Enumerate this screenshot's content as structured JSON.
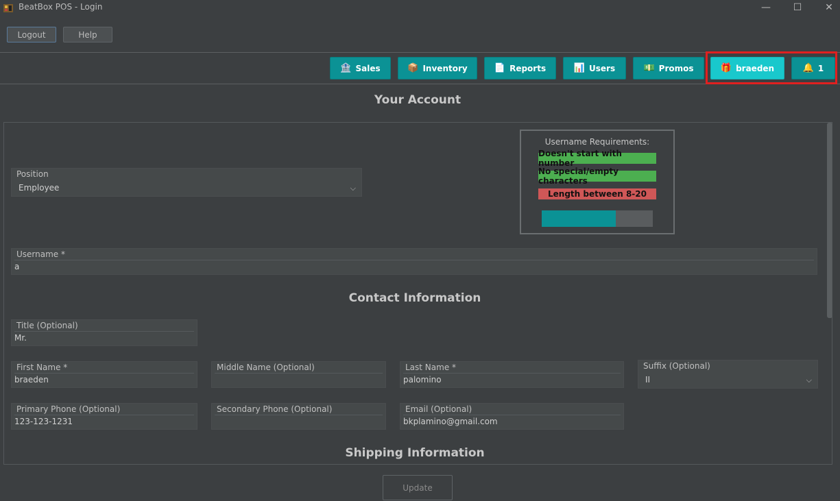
{
  "window": {
    "title": "BeatBox POS - Login",
    "minimize": "—",
    "maximize": "☐",
    "close": "✕"
  },
  "toolbar": {
    "logout_label": "Logout",
    "help_label": "Help"
  },
  "nav": {
    "sales": {
      "label": "Sales",
      "icon": "🏦"
    },
    "inventory": {
      "label": "Inventory",
      "icon": "📦"
    },
    "reports": {
      "label": "Reports",
      "icon": "📄"
    },
    "users": {
      "label": "Users",
      "icon": "📊"
    },
    "promos": {
      "label": "Promos",
      "icon": "💵"
    },
    "user": {
      "label": "braeden",
      "icon": "🎁"
    },
    "notifications": {
      "label": "1",
      "icon": "🔔"
    }
  },
  "colors": {
    "accent": "#0b9295",
    "active_user": "#19c8cc",
    "highlight": "#e02020",
    "req_ok": "#4caf50",
    "req_bad": "#cf5757"
  },
  "page_title": "Your Account",
  "form": {
    "position": {
      "label": "Position",
      "value": "Employee"
    },
    "username": {
      "label": "Username *",
      "value": "a"
    },
    "contact_heading": "Contact Information",
    "title_field": {
      "label": "Title (Optional)",
      "value": "Mr."
    },
    "first_name": {
      "label": "First Name *",
      "value": "braeden"
    },
    "middle_name": {
      "label": "Middle Name (Optional)",
      "value": ""
    },
    "last_name": {
      "label": "Last Name *",
      "value": "palomino"
    },
    "suffix": {
      "label": "Suffix (Optional)",
      "value": "II"
    },
    "primary_phone": {
      "label": "Primary Phone (Optional)",
      "value": "123-123-1231"
    },
    "secondary_phone": {
      "label": "Secondary Phone (Optional)",
      "value": ""
    },
    "email": {
      "label": "Email (Optional)",
      "value": "bkplamino@gmail.com"
    },
    "shipping_heading": "Shipping Information"
  },
  "requirements": {
    "title": "Username Requirements:",
    "items": [
      {
        "label": "Doesn't start with number",
        "status": "ok"
      },
      {
        "label": "No special/empty characters",
        "status": "ok"
      },
      {
        "label": "Length between 8-20",
        "status": "bad"
      }
    ],
    "progress_fraction": 0.667
  },
  "update_label": "Update"
}
